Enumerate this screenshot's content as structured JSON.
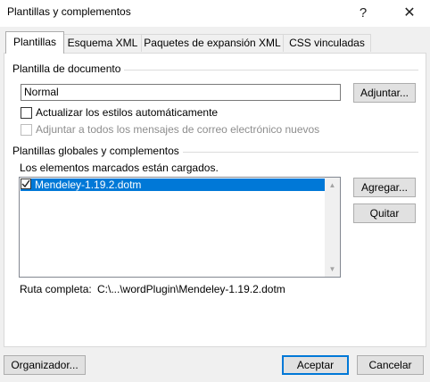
{
  "window": {
    "title": "Plantillas y complementos",
    "help_glyph": "?",
    "close_glyph": "✕"
  },
  "tabs": [
    {
      "label": "Plantillas"
    },
    {
      "label": "Esquema XML"
    },
    {
      "label": "Paquetes de expansión XML"
    },
    {
      "label": "CSS vinculadas"
    }
  ],
  "document_template": {
    "section_label": "Plantilla de documento",
    "value": "Normal",
    "attach_label": "Adjuntar...",
    "auto_update_label": "Actualizar los estilos automáticamente",
    "auto_update_checked": false,
    "attach_all_label": "Adjuntar a todos los mensajes de correo electrónico nuevos",
    "attach_all_enabled": false
  },
  "global_templates": {
    "section_label": "Plantillas globales y complementos",
    "hint": "Los elementos marcados están cargados.",
    "items": [
      {
        "label": "Mendeley-1.19.2.dotm",
        "checked": true,
        "selected": true
      }
    ],
    "add_label": "Agregar...",
    "remove_label": "Quitar",
    "full_path_label": "Ruta completa:",
    "full_path_value": "C:\\...\\wordPlugin\\Mendeley-1.19.2.dotm"
  },
  "footer": {
    "organizer_label": "Organizador...",
    "ok_label": "Aceptar",
    "cancel_label": "Cancelar"
  },
  "icons": {
    "check": "✓",
    "scroll_up": "▲",
    "scroll_down": "▼"
  },
  "colors": {
    "accent": "#0078d7",
    "selection": "#0078d7",
    "dialog_bg": "#f0f0f0"
  }
}
